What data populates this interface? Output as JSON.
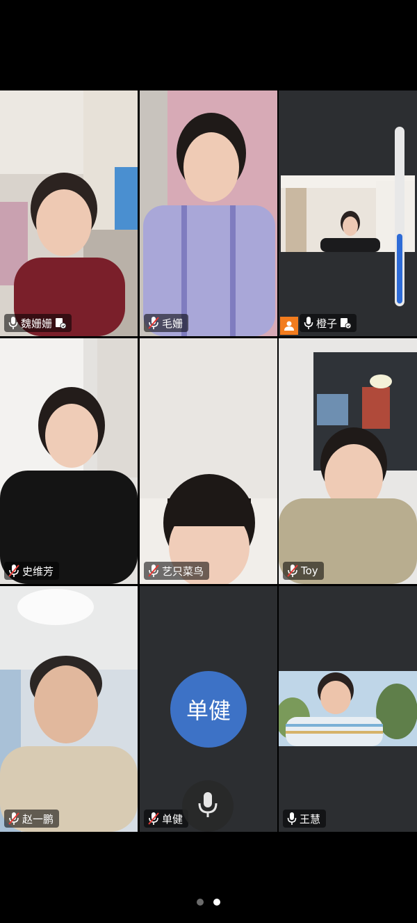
{
  "participants": [
    {
      "name": "魏姗姗",
      "muted": false,
      "has_share_icon": true
    },
    {
      "name": "毛姗",
      "muted": true,
      "has_share_icon": false
    },
    {
      "name": "橙子",
      "muted": false,
      "has_share_icon": true,
      "is_host": true,
      "active_speaker": true,
      "volume_level": 0.4
    },
    {
      "name": "史维芳",
      "muted": true,
      "has_share_icon": false
    },
    {
      "name": "艺只菜鸟",
      "muted": true,
      "has_share_icon": false
    },
    {
      "name": "Toy",
      "muted": true,
      "has_share_icon": false
    },
    {
      "name": "赵一鹏",
      "muted": true,
      "has_share_icon": false
    },
    {
      "name": "单健",
      "muted": true,
      "has_share_icon": false,
      "avatar_text": "单健"
    },
    {
      "name": "王慧",
      "muted": false,
      "has_share_icon": false
    }
  ],
  "pager": {
    "pages": 2,
    "current": 2
  },
  "colors": {
    "active_border": "#3fd27a",
    "avatar_bg": "#3d72c6",
    "host_badge": "#f27c1e",
    "volume_fill": "#2e6bd6"
  }
}
